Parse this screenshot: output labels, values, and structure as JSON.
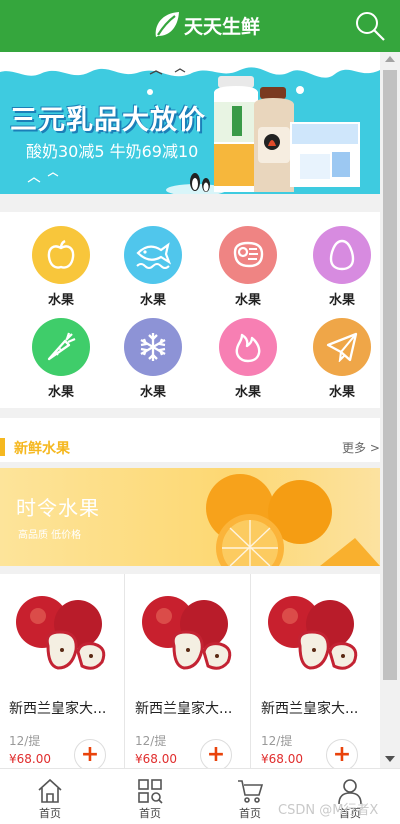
{
  "header": {
    "logo_text": "天天生鲜"
  },
  "banner": {
    "title": "三元乳品大放价",
    "subtitle": "酸奶30减5 牛奶69减10"
  },
  "categories": [
    {
      "label": "水果",
      "color": "#f8c63b",
      "icon": "apple-icon"
    },
    {
      "label": "水果",
      "color": "#50c6ec",
      "icon": "fish-icon"
    },
    {
      "label": "水果",
      "color": "#ef8483",
      "icon": "meat-icon"
    },
    {
      "label": "水果",
      "color": "#d78be0",
      "icon": "egg-icon"
    },
    {
      "label": "水果",
      "color": "#3fcd6a",
      "icon": "carrot-icon"
    },
    {
      "label": "水果",
      "color": "#8d93d6",
      "icon": "snowflake-icon"
    },
    {
      "label": "水果",
      "color": "#f77fb3",
      "icon": "fire-icon"
    },
    {
      "label": "水果",
      "color": "#efa648",
      "icon": "paper-plane-icon"
    }
  ],
  "section": {
    "title": "新鲜水果",
    "more": "更多 >"
  },
  "promo": {
    "title": "时令水果",
    "subtitle": "高品质 低价格"
  },
  "products": [
    {
      "name": "新西兰皇家大...",
      "unit": "12/提",
      "price": "¥68.00"
    },
    {
      "name": "新西兰皇家大...",
      "unit": "12/提",
      "price": "¥68.00"
    },
    {
      "name": "新西兰皇家大...",
      "unit": "12/提",
      "price": "¥68.00"
    }
  ],
  "nav": [
    {
      "label": "首页",
      "icon": "home-icon"
    },
    {
      "label": "首页",
      "icon": "category-search-icon"
    },
    {
      "label": "首页",
      "icon": "cart-icon"
    },
    {
      "label": "首页",
      "icon": "user-icon"
    }
  ],
  "watermark": "CSDN @M行者X"
}
